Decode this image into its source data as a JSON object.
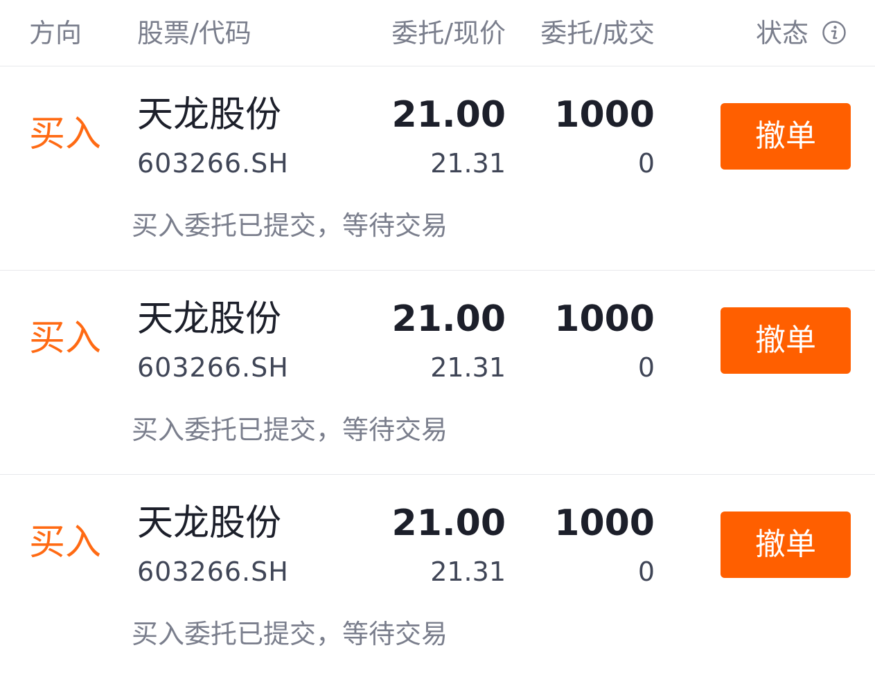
{
  "header": {
    "direction": "方向",
    "stock_code": "股票/代码",
    "order_price_current": "委托/现价",
    "order_filled": "委托/成交",
    "status": "状态"
  },
  "orders": [
    {
      "direction": "买入",
      "stock_name": "天龙股份",
      "code": "603266.SH",
      "order_price": "21.00",
      "current_price": "21.31",
      "order_qty": "1000",
      "filled_qty": "0",
      "action": "撤单",
      "status_text": "买入委托已提交，等待交易"
    },
    {
      "direction": "买入",
      "stock_name": "天龙股份",
      "code": "603266.SH",
      "order_price": "21.00",
      "current_price": "21.31",
      "order_qty": "1000",
      "filled_qty": "0",
      "action": "撤单",
      "status_text": "买入委托已提交，等待交易"
    },
    {
      "direction": "买入",
      "stock_name": "天龙股份",
      "code": "603266.SH",
      "order_price": "21.00",
      "current_price": "21.31",
      "order_qty": "1000",
      "filled_qty": "0",
      "action": "撤单",
      "status_text": "买入委托已提交，等待交易"
    }
  ],
  "colors": {
    "buy": "#ff6a13",
    "button": "#ff5f00",
    "primary_text": "#1c1f2a",
    "secondary_text": "#7a7e8c"
  },
  "icons": {
    "status_info": "info-icon"
  }
}
